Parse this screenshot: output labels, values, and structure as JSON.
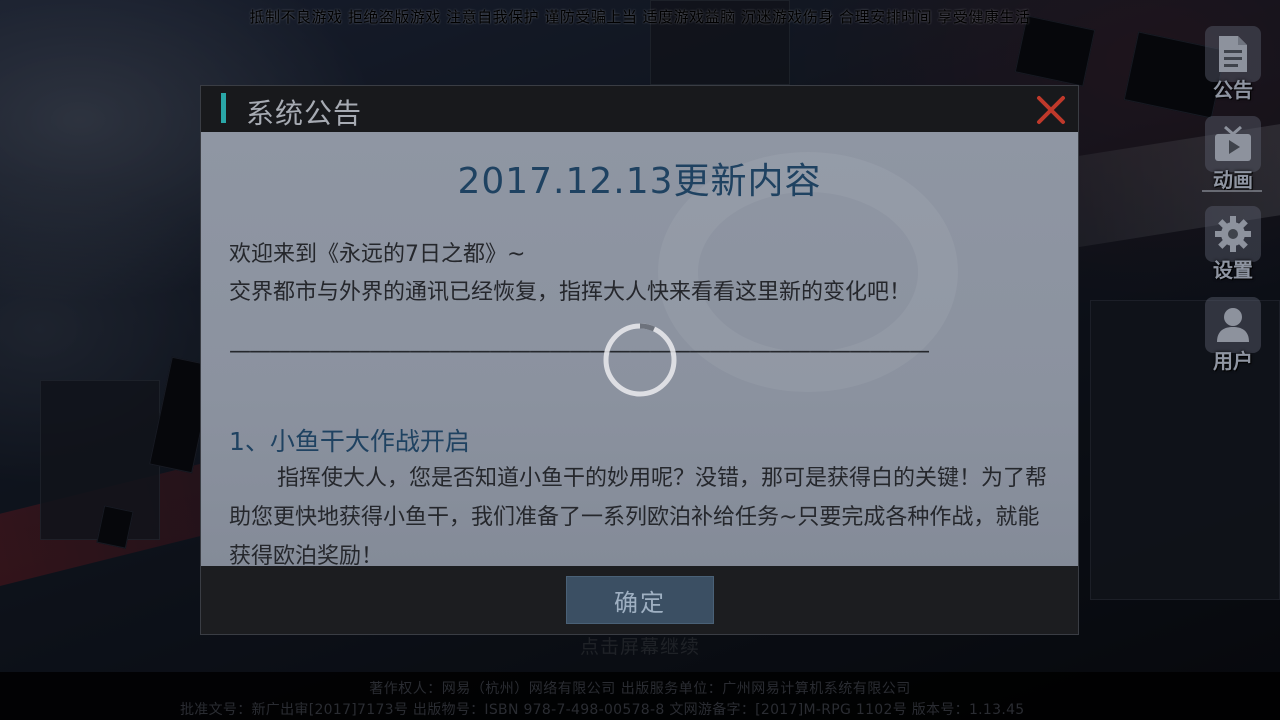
{
  "health_notice": "抵制不良游戏 拒绝盗版游戏 注意自我保护 谨防受骗上当 适度游戏益脑 沉迷游戏伤身 合理安排时间 享受健康生活",
  "side_menu": {
    "announcement": "公告",
    "animation": "动画",
    "settings": "设置",
    "user": "用户"
  },
  "dialog": {
    "title": "系统公告",
    "update_title": "2017.12.13更新内容",
    "intro_line1": "欢迎来到《永远的7日之都》~",
    "intro_line2": "交界都市与外界的通讯已经恢复，指挥大人快来看看这里新的变化吧！",
    "divider": "——————————————————————————————————————",
    "section1_title": "1、小鱼干大作战开启",
    "section1_body": "指挥使大人，您是否知道小鱼干的妙用呢？没错，那可是获得白的关键！为了帮助您更快地获得小鱼干，我们准备了一系列欧泊补给任务~只要完成各种作战，就能获得欧泊奖励！",
    "confirm_label": "确定"
  },
  "tap_hint": "点击屏幕继续",
  "footer": {
    "copyright": "著作权人：网易（杭州）网络有限公司 出版服务单位：广州网易计算机系统有限公司",
    "approval": "批准文号：新广出审[2017]7173号 出版物号：ISBN 978-7-498-00578-8 文网游备字：[2017]M-RPG 1102号 版本号：1.13.45"
  },
  "colors": {
    "accent_teal": "#2aa7a8",
    "close_red": "#c0392b",
    "title_blue": "#1f4261",
    "button_bg": "#3b4f63"
  },
  "icons": [
    "document-icon",
    "tv-play-icon",
    "gear-icon",
    "user-icon",
    "close-icon",
    "loading-spinner-icon"
  ]
}
